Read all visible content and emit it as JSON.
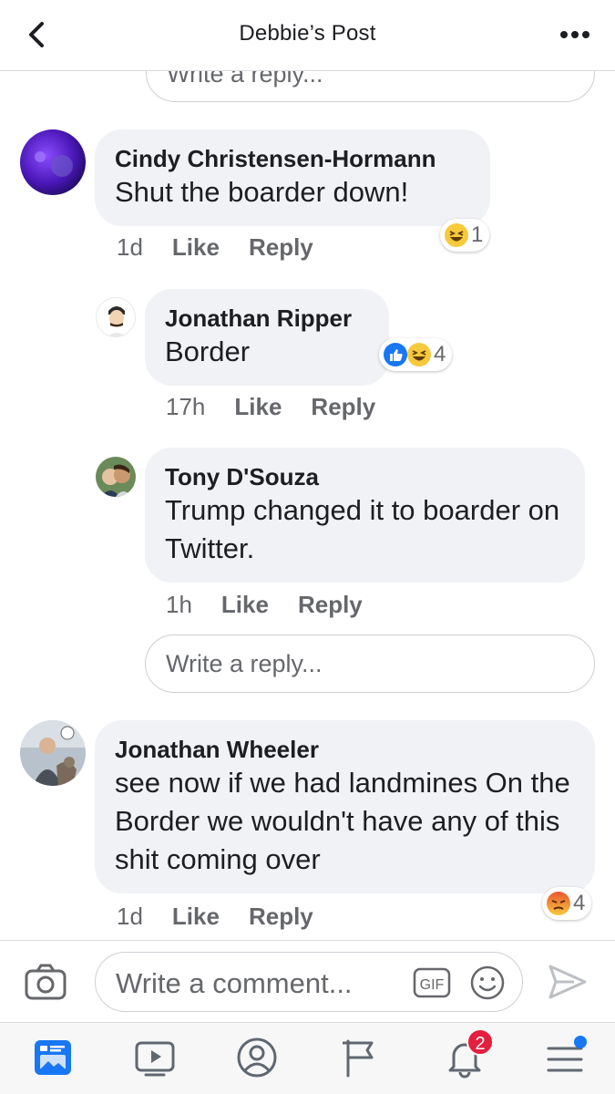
{
  "header": {
    "title": "Debbie’s Post"
  },
  "top_reply": {
    "placeholder": "Write a reply..."
  },
  "comments": [
    {
      "author": "Cindy Christensen-Hormann",
      "text": "Shut the boarder down!",
      "time": "1d",
      "like": "Like",
      "reply": "Reply",
      "reactions": {
        "types": [
          "haha"
        ],
        "count": "1"
      }
    },
    {
      "author": "Jonathan Ripper",
      "text": "Border",
      "time": "17h",
      "like": "Like",
      "reply": "Reply",
      "reactions": {
        "types": [
          "like",
          "haha"
        ],
        "count": "4"
      }
    },
    {
      "author": "Tony D'Souza",
      "text": "Trump changed it to boarder on Twitter.",
      "time": "1h",
      "like": "Like",
      "reply": "Reply"
    },
    {
      "author": "Jonathan Wheeler",
      "text": "see now if we had landmines On the Border we wouldn't have any of this shit coming over",
      "time": "1d",
      "like": "Like",
      "reply": "Reply",
      "reactions": {
        "types": [
          "angry"
        ],
        "count": "4"
      }
    }
  ],
  "mid_reply": {
    "placeholder": "Write a reply..."
  },
  "composer": {
    "placeholder": "Write a comment...",
    "gif_label": "GIF"
  },
  "tabbar": {
    "tabs": [
      "news-feed",
      "watch",
      "profile",
      "pages",
      "notifications",
      "menu"
    ],
    "notification_badge": "2"
  },
  "colors": {
    "accent": "#1877f2",
    "bubble": "#f0f2f5",
    "badge": "#e41e3f"
  }
}
